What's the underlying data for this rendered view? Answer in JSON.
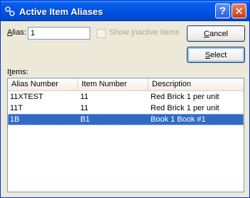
{
  "window": {
    "title": "Active Item Aliases",
    "help_glyph": "?",
    "close_glyph": "✕"
  },
  "alias": {
    "label_accel": "A",
    "label_rest": "lias:",
    "value": "1"
  },
  "show_inactive": {
    "label_pre": "Show ",
    "label_accel": "I",
    "label_post": "nactive Items",
    "checked": false,
    "enabled": false
  },
  "buttons": {
    "cancel": {
      "accel": "C",
      "rest": "ancel"
    },
    "select": {
      "accel": "S",
      "rest": "elect"
    }
  },
  "items": {
    "label_pre": "I",
    "label_accel": "t",
    "label_post": "ems:",
    "columns": [
      "Alias Number",
      "Item Number",
      "Description"
    ],
    "rows": [
      {
        "alias": "11XTEST",
        "item": "11",
        "description": "Red Brick 1 per unit"
      },
      {
        "alias": "11T",
        "item": "11",
        "description": "Red Brick 1 per unit"
      },
      {
        "alias": "1B",
        "item": "B1",
        "description": "Book 1 Book #1"
      }
    ],
    "selected_row": 2
  }
}
